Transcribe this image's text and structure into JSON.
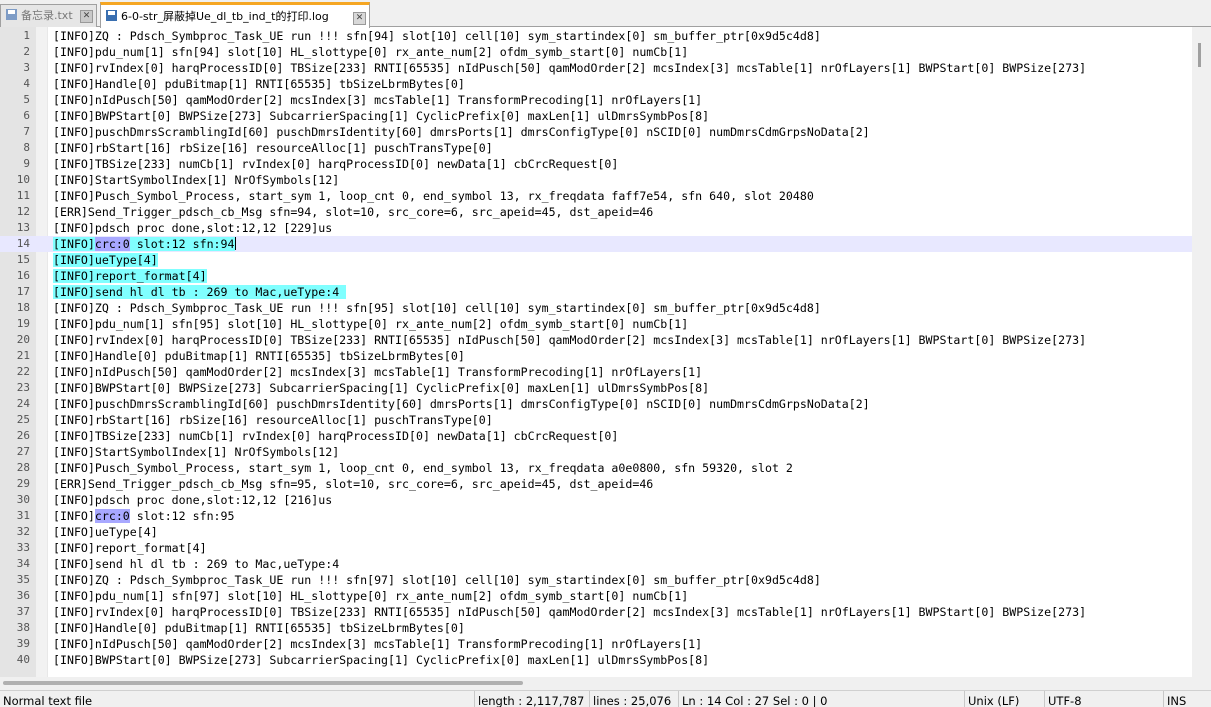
{
  "tabs": [
    {
      "label": "备忘录.txt",
      "active": false
    },
    {
      "label": "6-0-str_屏蔽掉Ue_dl_tb_ind_t的打印.log",
      "active": true
    }
  ],
  "editor": {
    "lines": [
      {
        "n": "1",
        "t": "[INFO]ZQ : Pdsch_Symbproc_Task_UE run !!! sfn[94] slot[10] cell[10] sym_startindex[0] sm_buffer_ptr[0x9d5c4d8]"
      },
      {
        "n": "2",
        "t": "[INFO]pdu_num[1] sfn[94] slot[10] HL_slottype[0] rx_ante_num[2] ofdm_symb_start[0] numCb[1]"
      },
      {
        "n": "3",
        "t": "[INFO]rvIndex[0] harqProcessID[0] TBSize[233] RNTI[65535] nIdPusch[50] qamModOrder[2] mcsIndex[3] mcsTable[1] nrOfLayers[1] BWPStart[0] BWPSize[273]"
      },
      {
        "n": "4",
        "t": "[INFO]Handle[0] pduBitmap[1] RNTI[65535] tbSizeLbrmBytes[0]"
      },
      {
        "n": "5",
        "t": "[INFO]nIdPusch[50] qamModOrder[2] mcsIndex[3] mcsTable[1] TransformPrecoding[1] nrOfLayers[1]"
      },
      {
        "n": "6",
        "t": "[INFO]BWPStart[0] BWPSize[273] SubcarrierSpacing[1] CyclicPrefix[0] maxLen[1] ulDmrsSymbPos[8]"
      },
      {
        "n": "7",
        "t": "[INFO]puschDmrsScramblingId[60] puschDmrsIdentity[60] dmrsPorts[1] dmrsConfigType[0] nSCID[0] numDmrsCdmGrpsNoData[2]"
      },
      {
        "n": "8",
        "t": "[INFO]rbStart[16] rbSize[16] resourceAlloc[1] puschTransType[0]"
      },
      {
        "n": "9",
        "t": "[INFO]TBSize[233] numCb[1] rvIndex[0] harqProcessID[0] newData[1] cbCrcRequest[0]"
      },
      {
        "n": "10",
        "t": "[INFO]StartSymbolIndex[1] NrOfSymbols[12]"
      },
      {
        "n": "11",
        "t": "[INFO]Pusch_Symbol_Process, start_sym 1, loop_cnt 0, end_symbol 13, rx_freqdata faff7e54, sfn 640, slot 20480"
      },
      {
        "n": "12",
        "t": "[ERR]Send_Trigger_pdsch_cb_Msg sfn=94, slot=10, src_core=6, src_apeid=45, dst_apeid=46"
      },
      {
        "n": "13",
        "t": "[INFO]pdsch proc done,slot:12,12 [229]us"
      },
      {
        "n": "14",
        "t": " slot:12 sfn:94",
        "pre": "[INFO]",
        "sel": "crc:0",
        "current": true,
        "cyan": true,
        "caret": true
      },
      {
        "n": "15",
        "t": "[INFO]ueType[4]",
        "cyan": true
      },
      {
        "n": "16",
        "t": "[INFO]report_format[4]",
        "cyan": true
      },
      {
        "n": "17",
        "t": "[INFO]send hl dl tb : 269 to Mac,ueType:4 ",
        "cyan": true
      },
      {
        "n": "18",
        "t": "[INFO]ZQ : Pdsch_Symbproc_Task_UE run !!! sfn[95] slot[10] cell[10] sym_startindex[0] sm_buffer_ptr[0x9d5c4d8]"
      },
      {
        "n": "19",
        "t": "[INFO]pdu_num[1] sfn[95] slot[10] HL_slottype[0] rx_ante_num[2] ofdm_symb_start[0] numCb[1]"
      },
      {
        "n": "20",
        "t": "[INFO]rvIndex[0] harqProcessID[0] TBSize[233] RNTI[65535] nIdPusch[50] qamModOrder[2] mcsIndex[3] mcsTable[1] nrOfLayers[1] BWPStart[0] BWPSize[273]"
      },
      {
        "n": "21",
        "t": "[INFO]Handle[0] pduBitmap[1] RNTI[65535] tbSizeLbrmBytes[0]"
      },
      {
        "n": "22",
        "t": "[INFO]nIdPusch[50] qamModOrder[2] mcsIndex[3] mcsTable[1] TransformPrecoding[1] nrOfLayers[1]"
      },
      {
        "n": "23",
        "t": "[INFO]BWPStart[0] BWPSize[273] SubcarrierSpacing[1] CyclicPrefix[0] maxLen[1] ulDmrsSymbPos[8]"
      },
      {
        "n": "24",
        "t": "[INFO]puschDmrsScramblingId[60] puschDmrsIdentity[60] dmrsPorts[1] dmrsConfigType[0] nSCID[0] numDmrsCdmGrpsNoData[2]"
      },
      {
        "n": "25",
        "t": "[INFO]rbStart[16] rbSize[16] resourceAlloc[1] puschTransType[0]"
      },
      {
        "n": "26",
        "t": "[INFO]TBSize[233] numCb[1] rvIndex[0] harqProcessID[0] newData[1] cbCrcRequest[0]"
      },
      {
        "n": "27",
        "t": "[INFO]StartSymbolIndex[1] NrOfSymbols[12]"
      },
      {
        "n": "28",
        "t": "[INFO]Pusch_Symbol_Process, start_sym 1, loop_cnt 0, end_symbol 13, rx_freqdata a0e0800, sfn 59320, slot 2"
      },
      {
        "n": "29",
        "t": "[ERR]Send_Trigger_pdsch_cb_Msg sfn=95, slot=10, src_core=6, src_apeid=45, dst_apeid=46"
      },
      {
        "n": "30",
        "t": "[INFO]pdsch proc done,slot:12,12 [216]us"
      },
      {
        "n": "31",
        "t": " slot:12 sfn:95",
        "pre": "[INFO]",
        "sel": "crc:0"
      },
      {
        "n": "32",
        "t": "[INFO]ueType[4]"
      },
      {
        "n": "33",
        "t": "[INFO]report_format[4]"
      },
      {
        "n": "34",
        "t": "[INFO]send hl dl tb : 269 to Mac,ueType:4"
      },
      {
        "n": "35",
        "t": "[INFO]ZQ : Pdsch_Symbproc_Task_UE run !!! sfn[97] slot[10] cell[10] sym_startindex[0] sm_buffer_ptr[0x9d5c4d8]"
      },
      {
        "n": "36",
        "t": "[INFO]pdu_num[1] sfn[97] slot[10] HL_slottype[0] rx_ante_num[2] ofdm_symb_start[0] numCb[1]"
      },
      {
        "n": "37",
        "t": "[INFO]rvIndex[0] harqProcessID[0] TBSize[233] RNTI[65535] nIdPusch[50] qamModOrder[2] mcsIndex[3] mcsTable[1] nrOfLayers[1] BWPStart[0] BWPSize[273]"
      },
      {
        "n": "38",
        "t": "[INFO]Handle[0] pduBitmap[1] RNTI[65535] tbSizeLbrmBytes[0]"
      },
      {
        "n": "39",
        "t": "[INFO]nIdPusch[50] qamModOrder[2] mcsIndex[3] mcsTable[1] TransformPrecoding[1] nrOfLayers[1]"
      },
      {
        "n": "40",
        "t": "[INFO]BWPStart[0] BWPSize[273] SubcarrierSpacing[1] CyclicPrefix[0] maxLen[1] ulDmrsSymbPos[8]"
      }
    ]
  },
  "status": {
    "file_type": "Normal text file",
    "length": "length : 2,117,787",
    "lines": "lines : 25,076",
    "position": "Ln : 14    Col : 27    Sel : 0 | 0",
    "eol": "Unix (LF)",
    "encoding": "UTF-8",
    "mode": "INS"
  },
  "colors": {
    "highlight_cyan": "#80ffff",
    "selection": "#a8a8ff",
    "current_line": "#e8e8ff",
    "active_tab_accent": "#f5a623"
  }
}
